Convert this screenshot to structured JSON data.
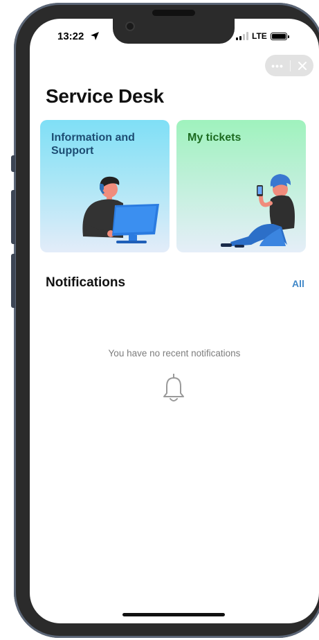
{
  "status_bar": {
    "time": "13:22",
    "network": "LTE",
    "icons": [
      "location-arrow-icon",
      "signal-icon",
      "battery-icon"
    ]
  },
  "capsule": {
    "more_label": "•••",
    "icons": [
      "more-icon",
      "close-icon"
    ]
  },
  "page": {
    "title": "Service Desk"
  },
  "cards": [
    {
      "label": "Information and Support",
      "color": "#1d4d73",
      "icon": "support-agent-illustration"
    },
    {
      "label": "My tickets",
      "color": "#1c6b20",
      "icon": "person-with-phone-illustration"
    }
  ],
  "notifications": {
    "title": "Notifications",
    "link_label": "All",
    "link_color": "#3f87c8",
    "empty_text": "You have no recent notifications",
    "empty_icon": "bell-icon"
  }
}
